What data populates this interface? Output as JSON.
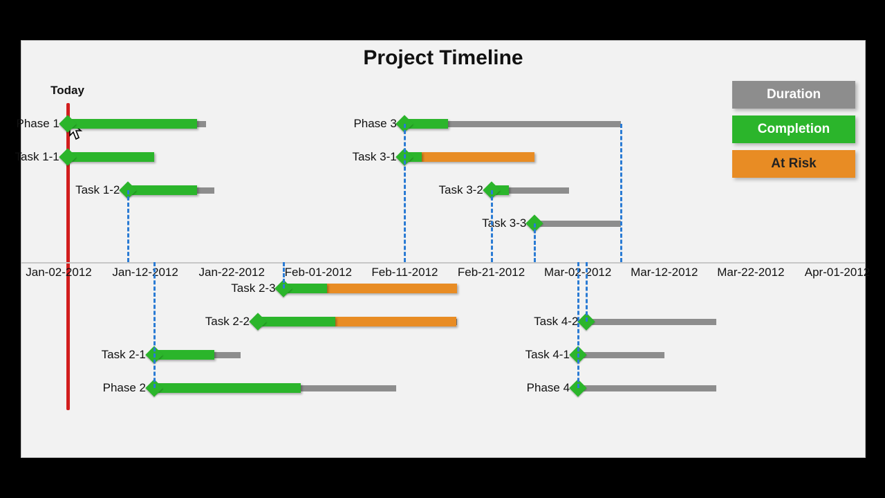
{
  "chart_data": {
    "type": "gantt",
    "title": "Project Timeline",
    "today_label": "Today",
    "today_date": "Jan-03-2012",
    "x_ticks": [
      "Jan-02-2012",
      "Jan-12-2012",
      "Jan-22-2012",
      "Feb-01-2012",
      "Feb-11-2012",
      "Feb-21-2012",
      "Mar-02-2012",
      "Mar-12-2012",
      "Mar-22-2012",
      "Apr-01-2012"
    ],
    "x_range": [
      "Jan-02-2012",
      "Apr-01-2012"
    ],
    "legend": [
      {
        "label": "Duration",
        "color": "#8d8d8d"
      },
      {
        "label": "Completion",
        "color": "#2bb52b"
      },
      {
        "label": "At Risk",
        "color": "#e88c24"
      }
    ],
    "tasks_above_axis": [
      {
        "name": "Phase 1",
        "start": "Jan-03-2012",
        "end": "Jan-19-2012",
        "completion_end": "Jan-18-2012",
        "risk_end": null
      },
      {
        "name": "Task 1-1",
        "start": "Jan-03-2012",
        "end": "Jan-13-2012",
        "completion_end": "Jan-13-2012",
        "risk_end": null
      },
      {
        "name": "Task 1-2",
        "start": "Jan-10-2012",
        "end": "Jan-20-2012",
        "completion_end": "Jan-18-2012",
        "risk_end": null
      },
      {
        "name": "Phase 3",
        "start": "Feb-11-2012",
        "end": "Mar-07-2012",
        "completion_end": "Feb-16-2012",
        "risk_end": null
      },
      {
        "name": "Task 3-1",
        "start": "Feb-11-2012",
        "end": "Feb-26-2012",
        "completion_end": "Feb-13-2012",
        "risk_end": "Feb-26-2012"
      },
      {
        "name": "Task 3-2",
        "start": "Feb-21-2012",
        "end": "Mar-01-2012",
        "completion_end": "Feb-23-2012",
        "risk_end": null
      },
      {
        "name": "Task 3-3",
        "start": "Feb-26-2012",
        "end": "Mar-07-2012",
        "completion_end": "Feb-26-2012",
        "risk_end": null
      }
    ],
    "tasks_below_axis": [
      {
        "name": "Task 2-3",
        "start": "Jan-28-2012",
        "end": "Feb-17-2012",
        "completion_end": "Feb-02-2012",
        "risk_end": "Feb-17-2012"
      },
      {
        "name": "Task 2-2",
        "start": "Jan-25-2012",
        "end": "Feb-17-2012",
        "completion_end": "Feb-03-2012",
        "risk_end": "Feb-17-2012"
      },
      {
        "name": "Task 2-1",
        "start": "Jan-13-2012",
        "end": "Jan-23-2012",
        "completion_end": "Jan-20-2012",
        "risk_end": null
      },
      {
        "name": "Phase 2",
        "start": "Jan-13-2012",
        "end": "Feb-10-2012",
        "completion_end": "Jan-30-2012",
        "risk_end": null
      },
      {
        "name": "Task 4-2",
        "start": "Mar-03-2012",
        "end": "Mar-18-2012",
        "completion_end": "Mar-03-2012",
        "risk_end": null
      },
      {
        "name": "Task 4-1",
        "start": "Mar-02-2012",
        "end": "Mar-12-2012",
        "completion_end": "Mar-02-2012",
        "risk_end": null
      },
      {
        "name": "Phase 4",
        "start": "Mar-02-2012",
        "end": "Mar-18-2012",
        "completion_end": "Mar-02-2012",
        "risk_end": null
      }
    ],
    "connectors": [
      {
        "from_task": "Task 1-2 start",
        "to": "axis"
      },
      {
        "from_task": "Task 1-2 end",
        "to": "axis"
      },
      {
        "from_task": "Task 2-3 end",
        "to": "axis"
      },
      {
        "from_task": "Phase 3 start",
        "to": "axis"
      },
      {
        "from_task": "Task 3-2 start",
        "to": "axis"
      },
      {
        "from_task": "Task 3-3 start",
        "to": "axis"
      },
      {
        "from_task": "Phase 4 start",
        "to": "axis"
      },
      {
        "from_task": "Task 4-2 start",
        "to": "axis"
      },
      {
        "from_task": "Phase 3 end",
        "to": "axis"
      }
    ]
  }
}
